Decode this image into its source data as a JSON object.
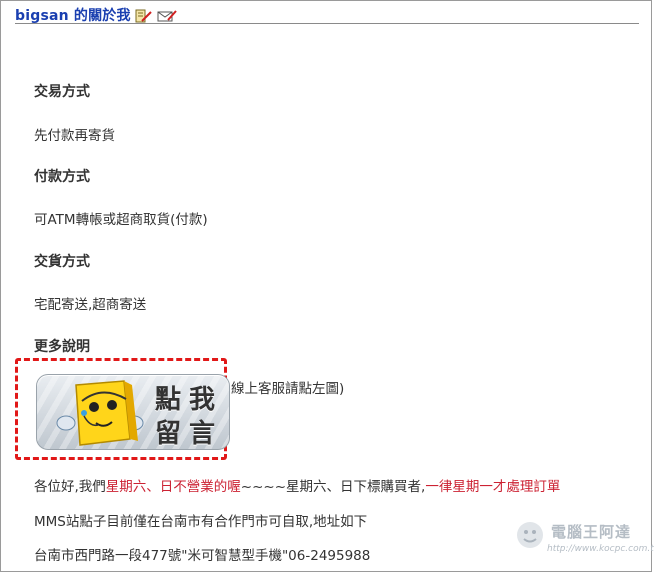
{
  "header": {
    "title": "bigsan 的關於我"
  },
  "sections": [
    {
      "title": "交易方式",
      "text": "先付款再寄貨"
    },
    {
      "title": "付款方式",
      "text": "可ATM轉帳或超商取貨(付款)"
    },
    {
      "title": "交貨方式",
      "text": "宅配寄送,超商寄送"
    },
    {
      "title": "更多說明",
      "text": "線上客服請點左圖)"
    }
  ],
  "badge": {
    "chars": [
      "點",
      "我",
      "留",
      "言"
    ]
  },
  "notice": {
    "part1": "各位好,我們",
    "part2": "星期六、日不營業的喔",
    "part3": "~~~~星期六、日下標購買者,",
    "part4": "一律星期一才處理訂單"
  },
  "mms_line": "MMS站點子目前僅在台南市有合作門市可自取,地址如下",
  "address_line": "台南市西門路一段477號\"米可智慧型手機\"06-2495988",
  "watermark": {
    "title": "電腦王阿達",
    "url": "http://www.kocpc.com.tw"
  },
  "colors": {
    "title_blue": "#1a3fb0",
    "highlight_red": "#cc2233",
    "badge_border_red": "#e11818"
  }
}
